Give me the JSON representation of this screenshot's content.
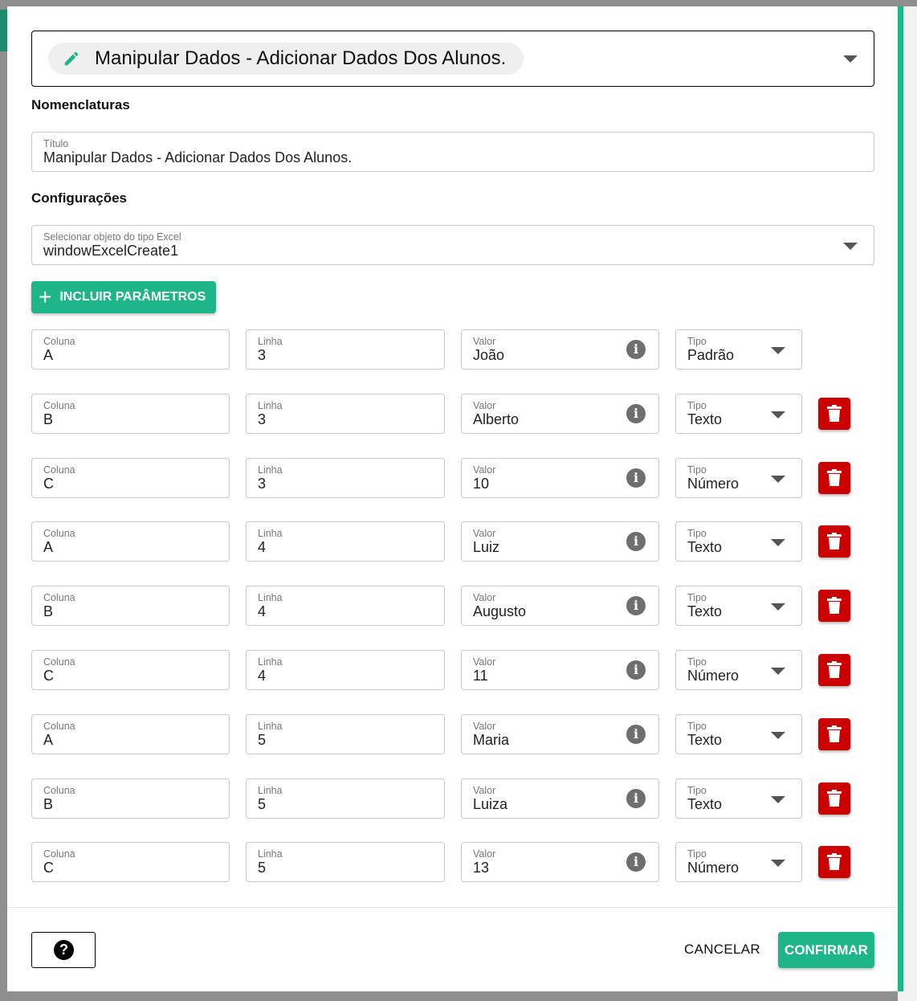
{
  "step": {
    "title": "Manipular Dados - Adicionar Dados Dos Alunos.",
    "icon": "pencil-icon"
  },
  "sections": {
    "nomenclaturas": "Nomenclaturas",
    "configuracoes": "Configurações"
  },
  "titulo": {
    "label": "Título",
    "value": "Manipular Dados - Adicionar Dados Dos Alunos."
  },
  "excel_select": {
    "label": "Selecionar objeto do tipo Excel",
    "value": "windowExcelCreate1"
  },
  "add_params": {
    "label": "INCLUIR PARÂMETROS",
    "icon": "plus-icon"
  },
  "param_labels": {
    "coluna": "Coluna",
    "linha": "Linha",
    "valor": "Valor",
    "tipo": "Tipo"
  },
  "params": [
    {
      "coluna": "A",
      "linha": "3",
      "valor": "João",
      "tipo": "Padrão",
      "deletable": false
    },
    {
      "coluna": "B",
      "linha": "3",
      "valor": "Alberto",
      "tipo": "Texto",
      "deletable": true
    },
    {
      "coluna": "C",
      "linha": "3",
      "valor": "10",
      "tipo": "Número",
      "deletable": true
    },
    {
      "coluna": "A",
      "linha": "4",
      "valor": "Luiz",
      "tipo": "Texto",
      "deletable": true
    },
    {
      "coluna": "B",
      "linha": "4",
      "valor": "Augusto",
      "tipo": "Texto",
      "deletable": true
    },
    {
      "coluna": "C",
      "linha": "4",
      "valor": "11",
      "tipo": "Número",
      "deletable": true
    },
    {
      "coluna": "A",
      "linha": "5",
      "valor": "Maria",
      "tipo": "Texto",
      "deletable": true
    },
    {
      "coluna": "B",
      "linha": "5",
      "valor": "Luiza",
      "tipo": "Texto",
      "deletable": true
    },
    {
      "coluna": "C",
      "linha": "5",
      "valor": "13",
      "tipo": "Número",
      "deletable": true
    }
  ],
  "footer": {
    "cancel": "CANCELAR",
    "confirm": "CONFIRMAR",
    "help_icon": "help-icon"
  },
  "colors": {
    "accent": "#1eb589",
    "danger": "#cc0000"
  }
}
